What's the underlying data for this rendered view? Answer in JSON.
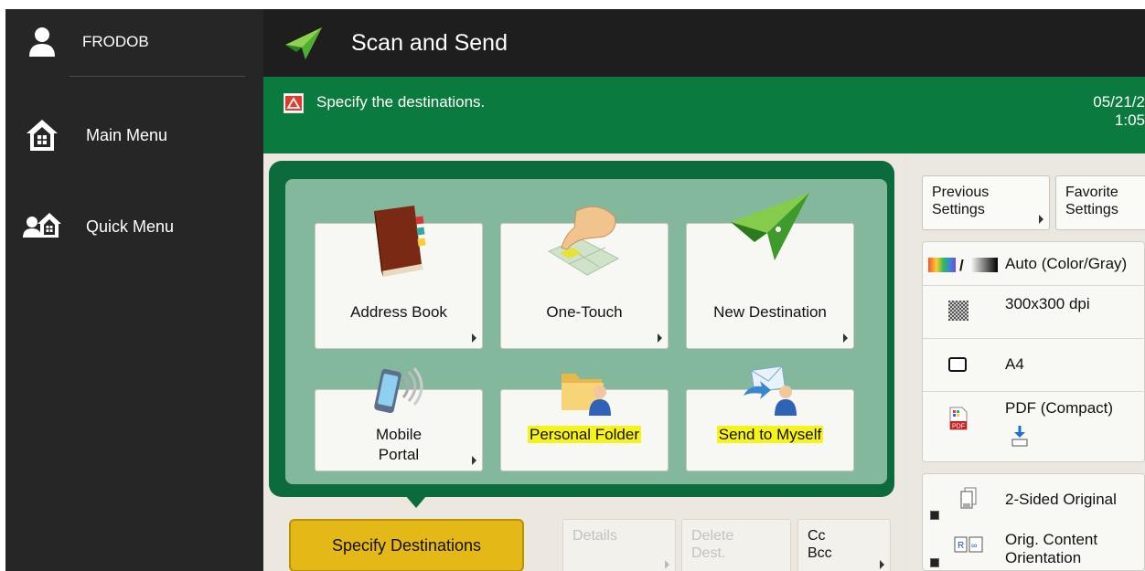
{
  "user": {
    "name": "FRODOB"
  },
  "sidebar": {
    "items": [
      {
        "label": "Main Menu"
      },
      {
        "label": "Quick Menu"
      }
    ]
  },
  "header": {
    "title": "Scan and Send"
  },
  "message": {
    "text": "Specify the destinations.",
    "date_line1": "05/21/2",
    "date_line2": "1:05"
  },
  "tiles": [
    {
      "label": "Address Book"
    },
    {
      "label": "One-Touch"
    },
    {
      "label": "New Destination"
    },
    {
      "label_line1": "Mobile",
      "label_line2": "Portal"
    },
    {
      "label": "Personal Folder"
    },
    {
      "label": "Send to Myself"
    }
  ],
  "bottom_buttons": {
    "specify": "Specify Destinations",
    "details": "Details",
    "delete_line1": "Delete",
    "delete_line2": "Dest.",
    "cc_line1": "Cc",
    "cc_line2": "Bcc"
  },
  "right": {
    "previous_line1": "Previous",
    "previous_line2": "Settings",
    "favorite_line1": "Favorite",
    "favorite_line2": "Settings",
    "color_mode": "Auto (Color/Gray)",
    "resolution": "300x300 dpi",
    "paper": "A4",
    "format": "PDF (Compact)",
    "two_sided": "2-Sided Original",
    "orientation_line1": "Orig. Content",
    "orientation_line2": "Orientation"
  },
  "colors": {
    "accent_green": "#0b7a3f",
    "highlight": "#f6f31b",
    "primary_button": "#e4b817"
  }
}
